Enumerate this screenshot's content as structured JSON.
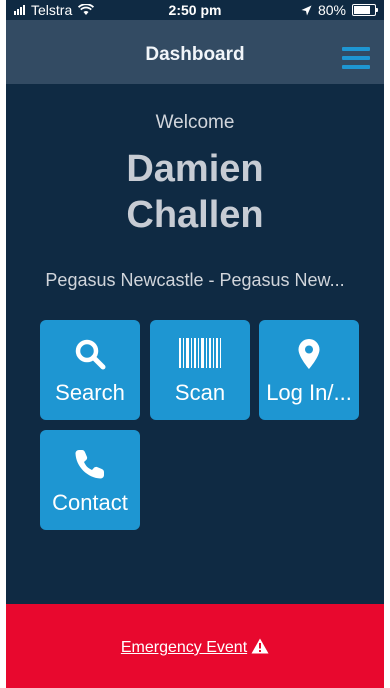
{
  "status_bar": {
    "carrier": "Telstra",
    "time": "2:50 pm",
    "battery": "80%",
    "battery_level": 0.8
  },
  "header": {
    "title": "Dashboard"
  },
  "profile": {
    "greeting": "Welcome",
    "first_name": "Damien",
    "last_name": "Challen",
    "organisation": "Pegasus Newcastle - Pegasus New..."
  },
  "tiles": [
    {
      "label": "Search",
      "icon": "search-icon"
    },
    {
      "label": "Scan",
      "icon": "barcode-icon"
    },
    {
      "label": "Log In/...",
      "icon": "location-pin-icon"
    },
    {
      "label": "Contact",
      "icon": "phone-icon"
    }
  ],
  "emergency": {
    "label": "Emergency Event",
    "icon": "warning-icon"
  },
  "colors": {
    "background": "#0f2a43",
    "navbar": "#334b63",
    "tile": "#1e96d2",
    "accent": "#1e96d2",
    "emergency": "#e8082e"
  }
}
